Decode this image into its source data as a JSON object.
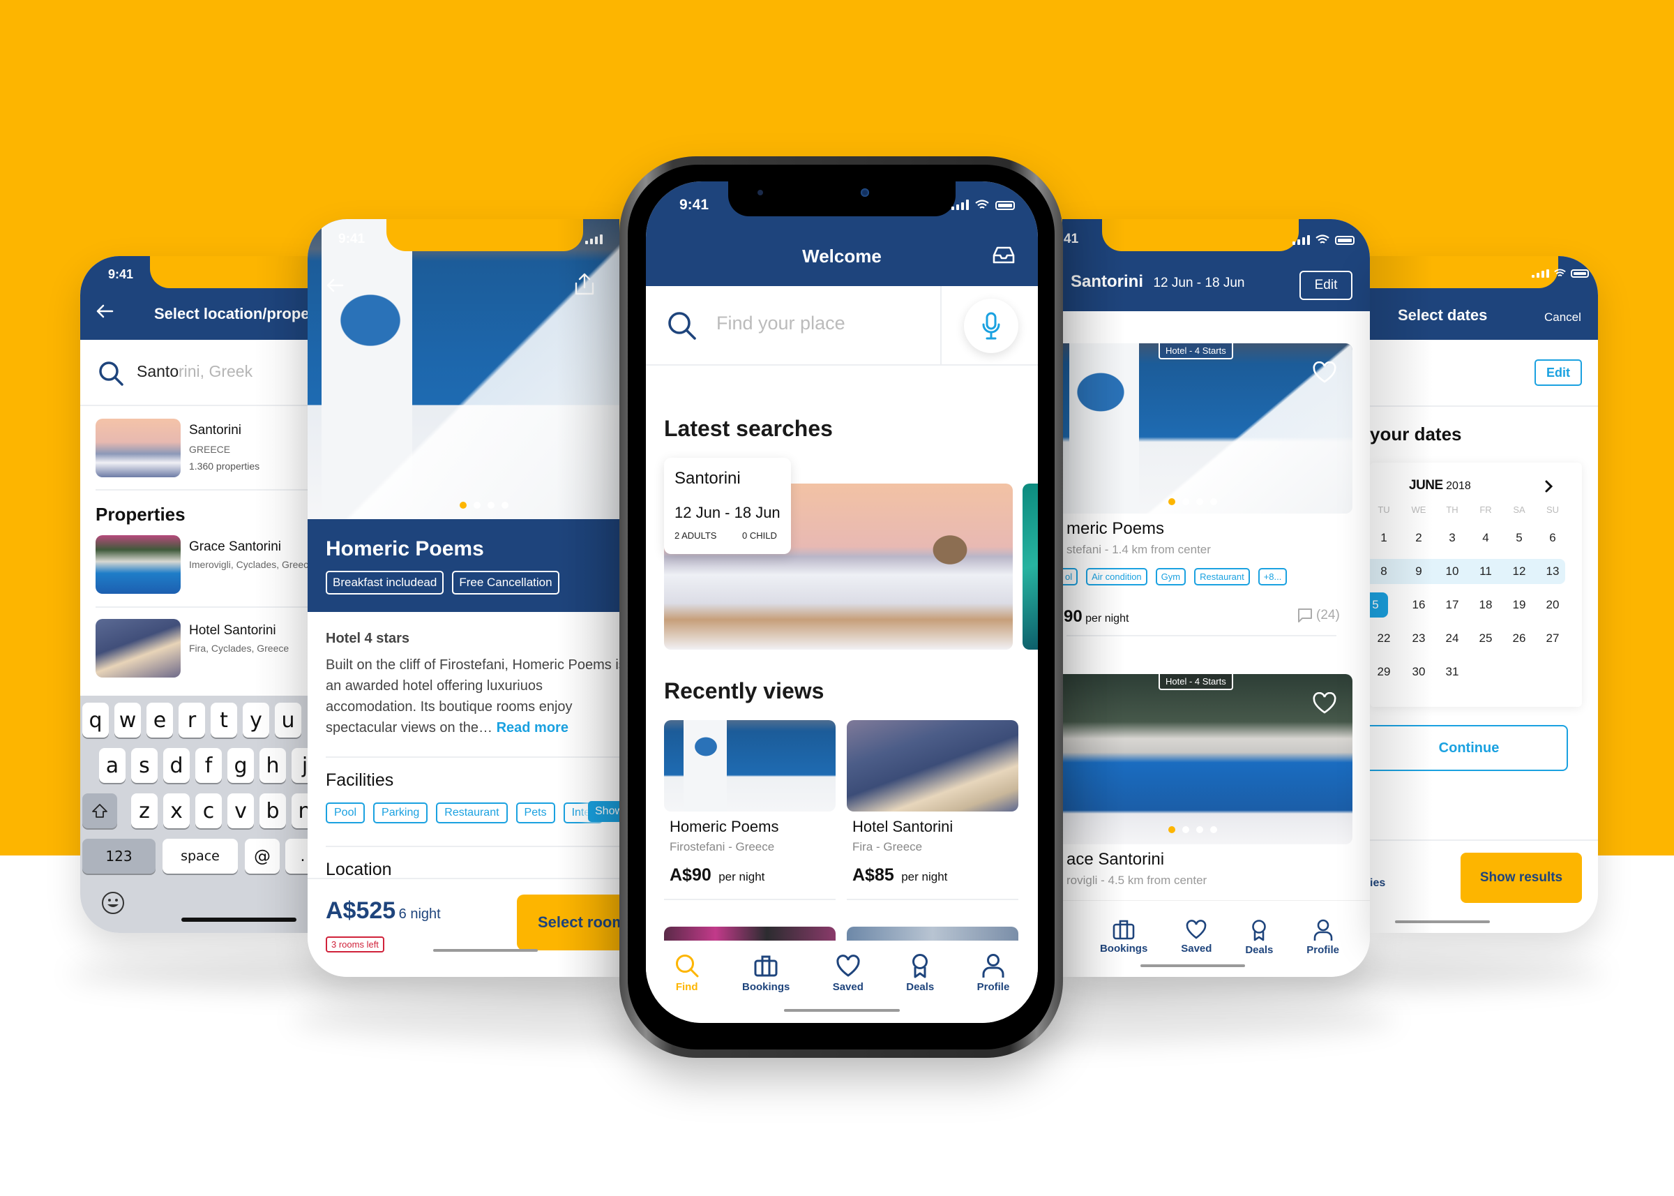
{
  "colors": {
    "brand_navy": "#1e447c",
    "accent_yellow": "#fdb500",
    "accent_blue": "#1aa1e0",
    "alert_red": "#d0223a"
  },
  "status_bar": {
    "time": "9:41"
  },
  "screen_search": {
    "title": "Select location/proper",
    "back_icon": "arrow-left-icon",
    "search_typed": "Santo",
    "search_suggest": "rini, Greek",
    "location_result": {
      "name": "Santorini",
      "country": "GREECE",
      "count": "1.360 properties"
    },
    "properties_heading": "Properties",
    "properties": [
      {
        "name": "Grace Santorini",
        "location": "Imerovigli, Cyclades, Greece"
      },
      {
        "name": "Hotel Santorini",
        "location": "Fira, Cyclades, Greece"
      }
    ],
    "keyboard": {
      "row1": [
        "q",
        "w",
        "e",
        "r",
        "t",
        "y",
        "u"
      ],
      "row2": [
        "a",
        "s",
        "d",
        "f",
        "g",
        "h",
        "j"
      ],
      "row3": [
        "z",
        "x",
        "c",
        "v",
        "b",
        "n"
      ],
      "numbers": "123",
      "space": "space",
      "at": "@",
      "dot": ".",
      "shift_icon": "shift-arrow-icon",
      "emoji_icon": "emoji-icon"
    }
  },
  "screen_detail": {
    "hotel_name": "Homeric Poems",
    "badges": [
      "Breakfast includead",
      "Free  Cancellation"
    ],
    "stars_label": "Hotel 4 stars",
    "description": "Built on the cliff of Firostefani, Homeric Poems is an awarded hotel offering luxuriuos accomodation. Its boutique rooms enjoy spectacular views on the…",
    "read_more": "Read more",
    "facilities_heading": "Facilities",
    "facilities": [
      "Pool",
      "Parking",
      "Restaurant",
      "Pets",
      "Inter"
    ],
    "show_more": "Show",
    "location_heading": "Location",
    "price": "A$525",
    "price_unit": "6 night",
    "rooms_left": "3 rooms left",
    "select_button": "Select room",
    "carousel": {
      "total": 4,
      "active": 1
    }
  },
  "screen_home": {
    "title": "Welcome",
    "inbox_icon": "inbox-icon",
    "search_placeholder": "Find your place",
    "mic_icon": "microphone-icon",
    "latest_heading": "Latest searches",
    "latest_search": {
      "place": "Santorini",
      "dates": "12 Jun - 18 Jun",
      "adults": "2 ADULTS",
      "children": "0 CHILD"
    },
    "recent_heading": "Recently views",
    "recent": [
      {
        "name": "Homeric Poems",
        "location": "Firostefani - Greece",
        "price": "A$90",
        "unit": "per night"
      },
      {
        "name": "Hotel Santorini",
        "location": "Fira - Greece",
        "price": "A$85",
        "unit": "per night"
      }
    ],
    "tabs": [
      {
        "label": "Find",
        "icon": "search-icon",
        "active": true
      },
      {
        "label": "Bookings",
        "icon": "suitcase-icon",
        "active": false
      },
      {
        "label": "Saved",
        "icon": "heart-icon",
        "active": false
      },
      {
        "label": "Deals",
        "icon": "award-ribbon-icon",
        "active": false
      },
      {
        "label": "Profile",
        "icon": "user-icon",
        "active": false
      }
    ]
  },
  "screen_results": {
    "status_time_partial": "41",
    "city": "Santorini",
    "dates": "12 Jun - 18 Jun",
    "edit": "Edit",
    "results": [
      {
        "tag": "Hotel - 4 Starts",
        "name": "meric Poems",
        "distance": "stefani - 1.4 km from center",
        "chips": [
          "ol",
          "Air condition",
          "Gym",
          "Restaurant",
          "+8..."
        ],
        "price": "90",
        "unit": "per night",
        "reviews": "(24)"
      },
      {
        "tag": "Hotel - 4 Starts",
        "name": "ace Santorini",
        "distance": "rovigli - 4.5 km from center"
      }
    ],
    "tabs": [
      "Bookings",
      "Saved",
      "Deals",
      "Profile"
    ]
  },
  "screen_dates": {
    "title": "Select dates",
    "cancel": "Cancel",
    "edit": "Edit",
    "heading_partial": "your dates",
    "month": "JUNE",
    "year": "2018",
    "weekdays": [
      "TU",
      "WE",
      "TH",
      "FR",
      "SA",
      "SU"
    ],
    "weeks": [
      [
        "1",
        "2",
        "3",
        "4",
        "5",
        "6"
      ],
      [
        "8",
        "9",
        "10",
        "11",
        "12",
        "13"
      ],
      [
        "5",
        "16",
        "17",
        "18",
        "19",
        "20"
      ],
      [
        "22",
        "23",
        "24",
        "25",
        "26",
        "27"
      ],
      [
        "29",
        "30",
        "31",
        "",
        "",
        ""
      ]
    ],
    "range_week_index": 1,
    "selected_label": "5",
    "continue": "Continue",
    "footer_partial": "ies",
    "show_results": "Show results"
  }
}
